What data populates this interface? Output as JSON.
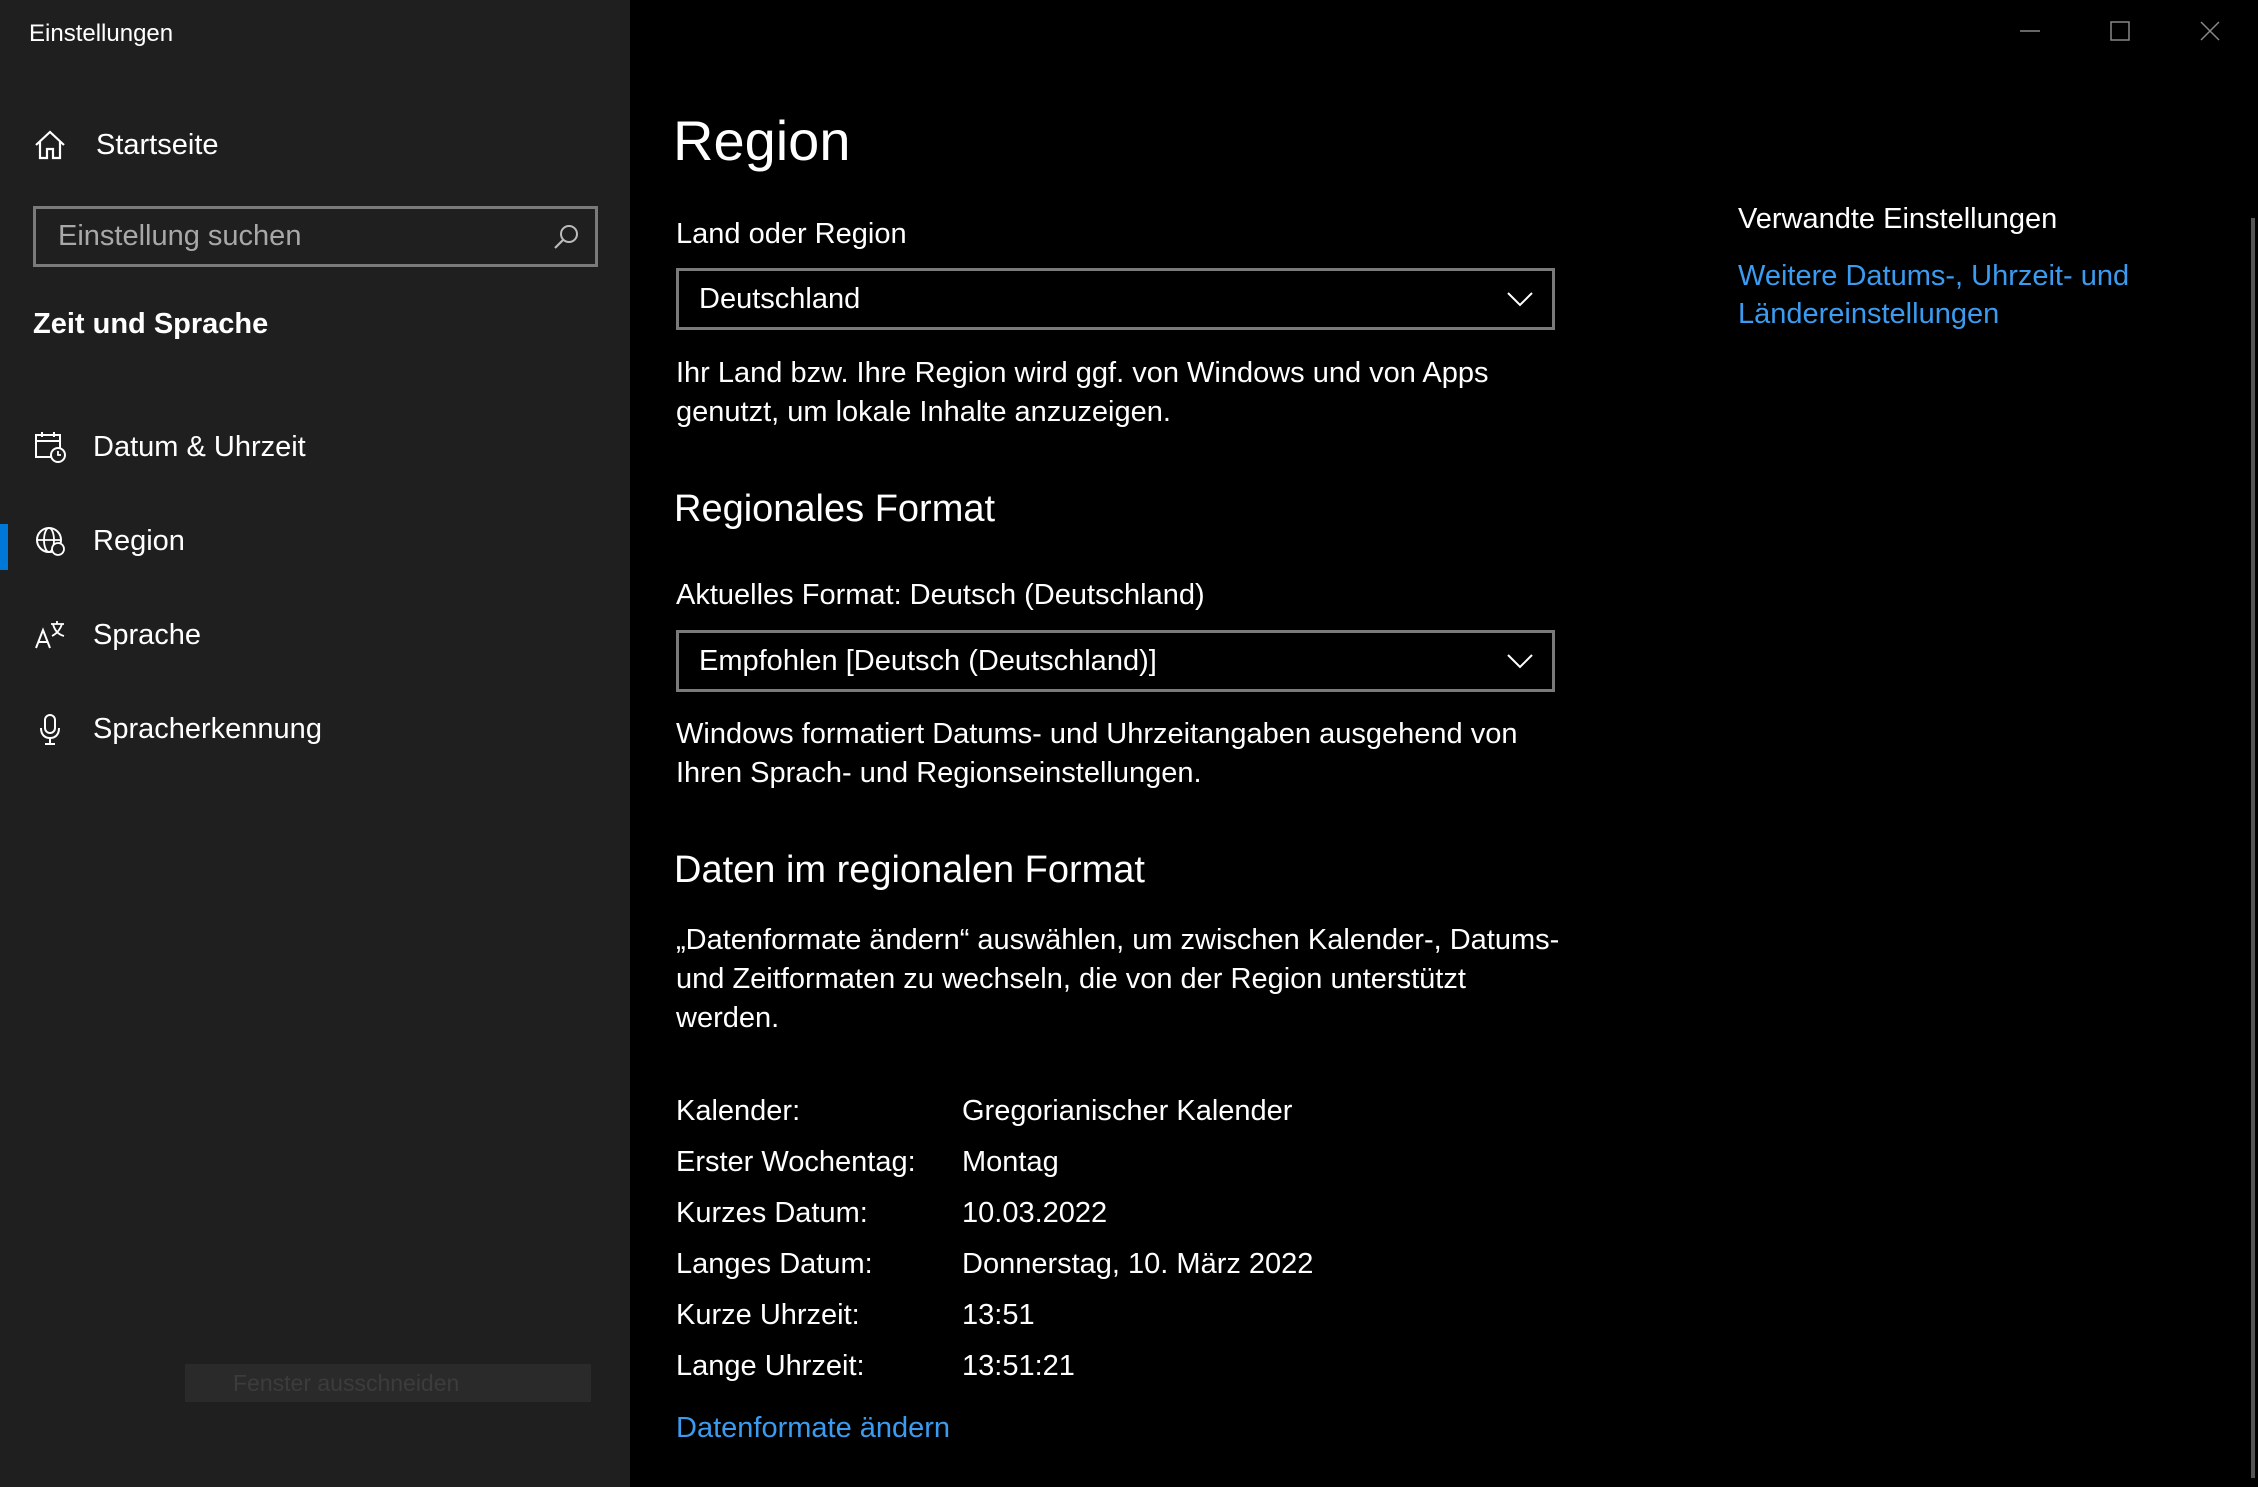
{
  "window": {
    "title": "Einstellungen",
    "controls": {
      "minimize": "minimize",
      "maximize": "maximize",
      "close": "close"
    }
  },
  "sidebar": {
    "home_label": "Startseite",
    "search_placeholder": "Einstellung suchen",
    "section_title": "Zeit und Sprache",
    "items": [
      {
        "label": "Datum & Uhrzeit",
        "icon": "calendar-clock-icon"
      },
      {
        "label": "Region",
        "icon": "globe-icon",
        "active": true
      },
      {
        "label": "Sprache",
        "icon": "language-icon"
      },
      {
        "label": "Spracherkennung",
        "icon": "microphone-icon"
      }
    ],
    "snip_label": "Fenster ausschneiden"
  },
  "main": {
    "title": "Region",
    "country": {
      "label": "Land oder Region",
      "value": "Deutschland",
      "description": "Ihr Land bzw. Ihre Region wird ggf. von Windows und von Apps genutzt, um lokale Inhalte anzuzeigen."
    },
    "regional_format": {
      "heading": "Regionales Format",
      "label": "Aktuelles Format: Deutsch (Deutschland)",
      "value": "Empfohlen [Deutsch (Deutschland)]",
      "description": "Windows formatiert Datums- und Uhrzeitangaben ausgehend von Ihren Sprach- und Regionseinstellungen."
    },
    "format_data": {
      "heading": "Daten im regionalen Format",
      "description": "„Datenformate ändern“ auswählen, um zwischen Kalender-, Datums- und Zeitformaten zu wechseln, die von der Region unterstützt werden.",
      "rows": [
        {
          "key": "Kalender:",
          "value": "Gregorianischer Kalender"
        },
        {
          "key": "Erster Wochentag:",
          "value": "Montag"
        },
        {
          "key": "Kurzes Datum:",
          "value": "10.03.2022"
        },
        {
          "key": "Langes Datum:",
          "value": "Donnerstag, 10. März 2022"
        },
        {
          "key": "Kurze Uhrzeit:",
          "value": "13:51"
        },
        {
          "key": "Lange Uhrzeit:",
          "value": "13:51:21"
        }
      ],
      "change_link": "Datenformate ändern"
    }
  },
  "related": {
    "title": "Verwandte Einstellungen",
    "link": "Weitere Datums-, Uhrzeit- und Ländereinstellungen"
  },
  "colors": {
    "accent": "#0078d7",
    "link": "#3b9bf0",
    "sidebar_bg": "#1f1f1f",
    "main_bg": "#000000"
  }
}
